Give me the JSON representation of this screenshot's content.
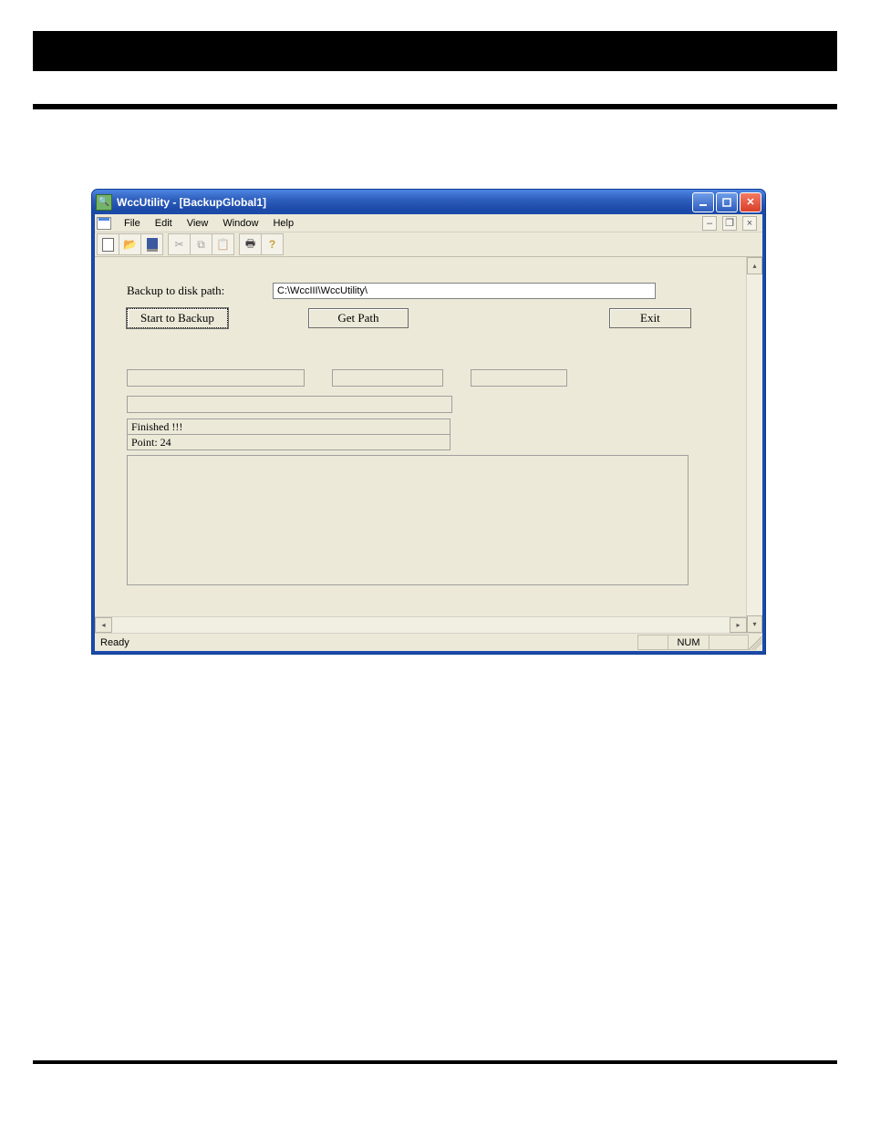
{
  "window": {
    "title": "WccUtility - [BackupGlobal1]"
  },
  "menus": [
    "File",
    "Edit",
    "View",
    "Window",
    "Help"
  ],
  "toolbar_icons": [
    "new",
    "open",
    "save",
    "cut",
    "copy",
    "paste",
    "print",
    "help"
  ],
  "form": {
    "backup_path_label": "Backup to disk path:",
    "backup_path_value": "C:\\WccIII\\WccUtility\\",
    "start_button": "Start to Backup",
    "get_path_button": "Get Path",
    "exit_button": "Exit",
    "status_finished": "Finished !!!",
    "status_point": "Point: 24"
  },
  "statusbar": {
    "ready": "Ready",
    "num": "NUM"
  }
}
